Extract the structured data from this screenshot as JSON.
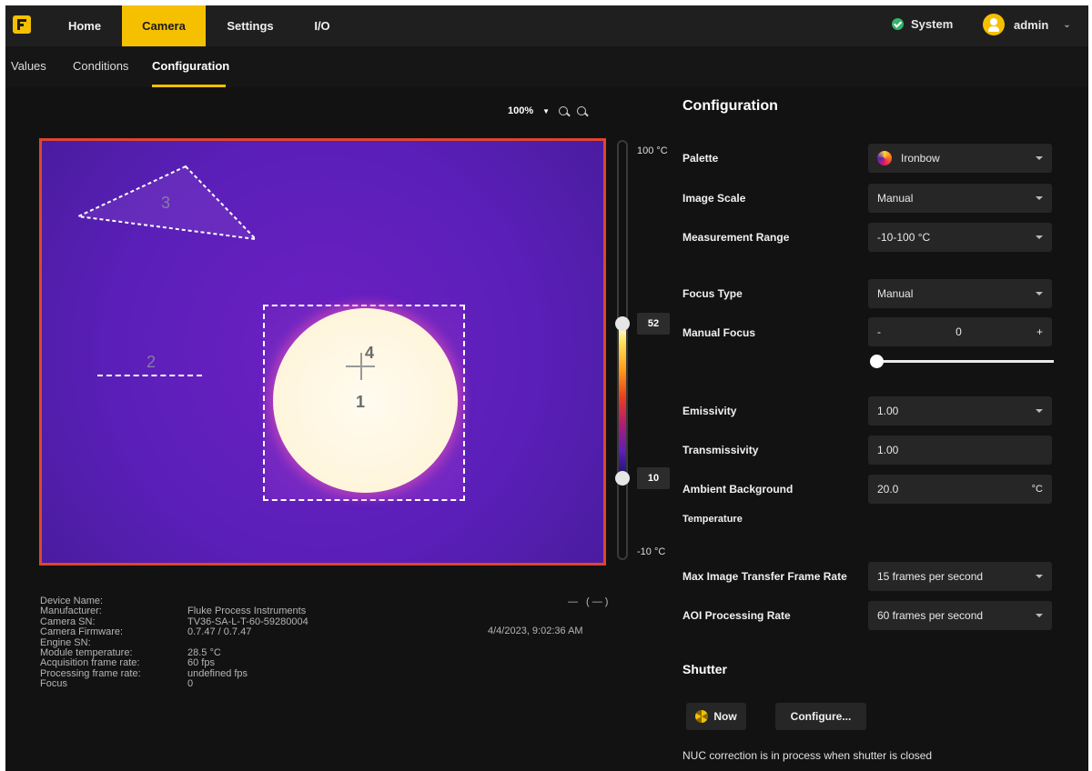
{
  "topnav": {
    "logo_icon": "fluke-logo",
    "items": [
      {
        "label": "Home"
      },
      {
        "label": "Camera"
      },
      {
        "label": "Settings"
      },
      {
        "label": "I/O"
      }
    ],
    "active": "Camera",
    "system_label": "System",
    "user_label": "admin"
  },
  "subtabs": {
    "items": [
      {
        "label": "Values"
      },
      {
        "label": "Conditions"
      },
      {
        "label": "Configuration"
      }
    ],
    "active": "Configuration"
  },
  "viewer": {
    "zoom_label": "100%",
    "aoi_labels": {
      "triangle": "3",
      "line": "2",
      "spot": "1",
      "cross": "4"
    },
    "scale": {
      "max_label": "100 °C",
      "min_label": "-10 °C",
      "upper_value": "52",
      "lower_value": "10"
    }
  },
  "device_info": {
    "rows": [
      {
        "k": "Device Name:",
        "v": ""
      },
      {
        "k": "Manufacturer:",
        "v": "Fluke Process Instruments"
      },
      {
        "k": "Camera SN:",
        "v": "TV36-SA-L-T-60-59280004"
      },
      {
        "k": "Camera Firmware:",
        "v": "0.7.47 / 0.7.47"
      },
      {
        "k": "Engine SN:",
        "v": ""
      },
      {
        "k": "Module temperature:",
        "v": "28.5 °C"
      },
      {
        "k": "Acquisition frame rate:",
        "v": "60 fps"
      },
      {
        "k": "Processing frame rate:",
        "v": "undefined fps"
      },
      {
        "k": "Focus",
        "v": "0"
      }
    ],
    "timestamp": "4/4/2023, 9:02:36 AM",
    "minus_buttons": "— (—)"
  },
  "config": {
    "title": "Configuration",
    "palette": {
      "label": "Palette",
      "value": "Ironbow"
    },
    "image_scale": {
      "label": "Image Scale",
      "value": "Manual"
    },
    "measurement_range": {
      "label": "Measurement Range",
      "value": "-10-100 °C"
    },
    "focus_type": {
      "label": "Focus Type",
      "value": "Manual"
    },
    "manual_focus": {
      "label": "Manual Focus",
      "value": "0",
      "minus": "-",
      "plus": "+",
      "slider_level": 0
    },
    "emissivity": {
      "label": "Emissivity",
      "value": "1.00"
    },
    "transmissivity": {
      "label": "Transmissivity",
      "value": "1.00"
    },
    "ambient": {
      "label": "Ambient Background",
      "label2": "Temperature",
      "value": "20.0",
      "unit": "°C"
    },
    "max_transfer": {
      "label": "Max Image Transfer Frame Rate",
      "value": "15 frames per second"
    },
    "aoi_rate": {
      "label": "AOI Processing Rate",
      "value": "60 frames per second"
    },
    "shutter": {
      "title": "Shutter",
      "now_label": "Now",
      "configure_label": "Configure...",
      "note": "NUC correction is in process when shutter is closed"
    }
  },
  "colors": {
    "accent": "#f5c000",
    "border_red": "#e0452f",
    "bg": "#121212"
  }
}
